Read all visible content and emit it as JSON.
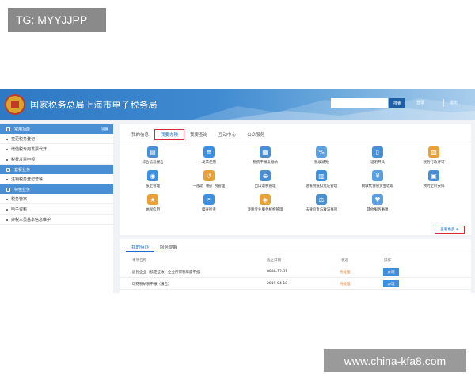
{
  "overlay": {
    "tg_label": "TG: MYYJJPP",
    "site_label": "www.china-kfa8.com"
  },
  "header": {
    "title": "国家税务总局上海市电子税务局",
    "search_placeholder": "",
    "search_label": "搜索",
    "login_label": "登录",
    "logout_label": "退出"
  },
  "sidebar": {
    "sections": [
      {
        "title": "常用功能",
        "more": "设置",
        "items": [
          "变更税务登记",
          "增值税专用发票代开",
          "税费发票申领"
        ]
      },
      {
        "title": "套餐业务",
        "items": [
          "注销税务登记套餐"
        ]
      },
      {
        "title": "特色业务",
        "items": [
          "税务管家",
          "电子资料",
          "办税人员基本信息维护"
        ]
      }
    ]
  },
  "main": {
    "tabs": [
      "我的信息",
      "我要办税",
      "我要查询",
      "互动中心",
      "公众服务"
    ],
    "active_tab": 1,
    "icons": [
      {
        "label": "综合信息报告",
        "icon": "document-icon",
        "color": "#4a8ed4",
        "glyph": "▤"
      },
      {
        "label": "发票使用",
        "icon": "invoice-icon",
        "color": "#3d8fe0",
        "glyph": "≣"
      },
      {
        "label": "税费申报及缴纳",
        "icon": "tax-filing-icon",
        "color": "#4a8ed4",
        "glyph": "▦"
      },
      {
        "label": "税收减免",
        "icon": "tax-reduction-icon",
        "color": "#5aa0e0",
        "glyph": "%"
      },
      {
        "label": "证明开具",
        "icon": "certificate-icon",
        "color": "#4a8ed4",
        "glyph": "▯"
      },
      {
        "label": "税务行政许可",
        "icon": "permit-icon",
        "color": "#e8a13a",
        "glyph": "▧"
      },
      {
        "label": "核定管理",
        "icon": "verify-icon",
        "color": "#3d8fe0",
        "glyph": "◉"
      },
      {
        "label": "一般退（抵）税管理",
        "icon": "refund-icon",
        "color": "#e8a13a",
        "glyph": "↺"
      },
      {
        "label": "出口退税管理",
        "icon": "export-refund-icon",
        "color": "#4a8ed4",
        "glyph": "⊕"
      },
      {
        "label": "增值税抵扣凭证管理",
        "icon": "deduction-icon",
        "color": "#3d8fe0",
        "glyph": "▥"
      },
      {
        "label": "税收代保管资金收取",
        "icon": "funds-icon",
        "color": "#5aa0e0",
        "glyph": "¥"
      },
      {
        "label": "预约定价安排",
        "icon": "calendar-icon",
        "color": "#4a8ed4",
        "glyph": "▣"
      },
      {
        "label": "纳税信用",
        "icon": "credit-icon",
        "color": "#e8a13a",
        "glyph": "★"
      },
      {
        "label": "稽查检查",
        "icon": "inspection-icon",
        "color": "#3d8fe0",
        "glyph": "⌕"
      },
      {
        "label": "涉税专业服务机构管理",
        "icon": "agency-icon",
        "color": "#e8a13a",
        "glyph": "◈"
      },
      {
        "label": "法律追责与救济事项",
        "icon": "legal-icon",
        "color": "#4a8ed4",
        "glyph": "⚖"
      },
      {
        "label": "其他服务事项",
        "icon": "other-service-icon",
        "color": "#5aa0e0",
        "glyph": "♥"
      }
    ],
    "more_label": "查看更多 ⊕"
  },
  "todo": {
    "tabs": [
      "我的待办",
      "服务提醒"
    ],
    "headers": {
      "name": "事项名称",
      "deadline": "截止日期",
      "status": "状态",
      "action": "操作"
    },
    "rows": [
      {
        "name": "居民企业（核定征收）企业所得税年度申报",
        "deadline": "9999-12-31",
        "status": "待处理",
        "action": "办理"
      },
      {
        "name": "印花税纳税申报（报告）",
        "deadline": "2019-04-18",
        "status": "待处理",
        "action": "办理"
      }
    ]
  }
}
